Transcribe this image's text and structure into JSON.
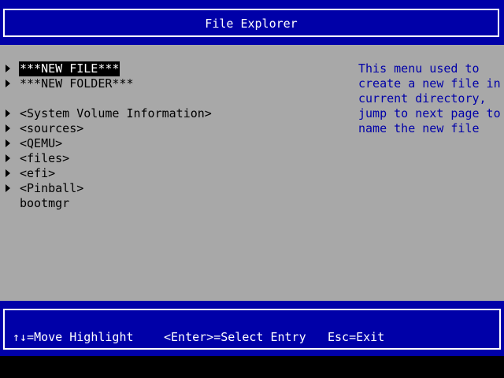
{
  "header": {
    "title": "File Explorer"
  },
  "entries": [
    {
      "label": "***NEW FILE***",
      "arrow": true,
      "selected": true
    },
    {
      "label": "***NEW FOLDER***",
      "arrow": true,
      "selected": false
    },
    {
      "label": "<System Volume Information>",
      "arrow": true,
      "selected": false
    },
    {
      "label": "<sources>",
      "arrow": true,
      "selected": false
    },
    {
      "label": "<QEMU>",
      "arrow": true,
      "selected": false
    },
    {
      "label": "<files>",
      "arrow": true,
      "selected": false
    },
    {
      "label": "<efi>",
      "arrow": true,
      "selected": false
    },
    {
      "label": "<Pinball>",
      "arrow": true,
      "selected": false
    },
    {
      "label": "bootmgr",
      "arrow": false,
      "selected": false
    }
  ],
  "help": {
    "lines": [
      "This menu used to",
      "create a new file in",
      "current directory,",
      "jump to next page to",
      "name the new file"
    ]
  },
  "footer": {
    "move_hint": "↑↓=Move Highlight",
    "select_hint": "<Enter>=Select Entry",
    "exit_hint": "Esc=Exit"
  },
  "colors": {
    "background": "#a8a8a8",
    "band": "#0000a8",
    "help_text": "#0000a8",
    "highlight_bg": "#000000",
    "highlight_fg": "#ffffff"
  }
}
